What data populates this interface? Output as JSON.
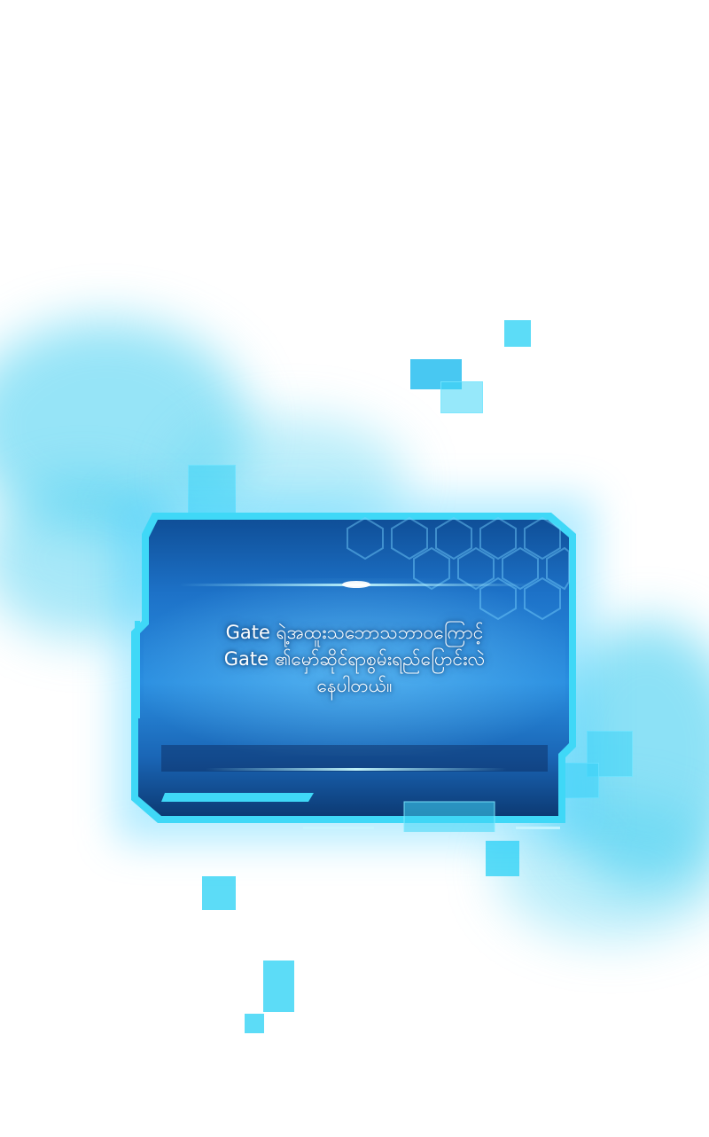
{
  "dialog": {
    "lines": [
      "Gate ရဲ့အထူးသဘောသဘာဝကြောင့်",
      "Gate ၏မှော်ဆိုင်ရာစွမ်းရည်ပြောင်းလဲ",
      "နေပါတယ်။"
    ]
  },
  "colors": {
    "panel_fill": "#1a6fc4",
    "panel_dark": "#0d3f7a",
    "panel_border": "#3fd8f7",
    "accent_cyan": "#40d6f6",
    "smoke": "#3fcdf0"
  }
}
